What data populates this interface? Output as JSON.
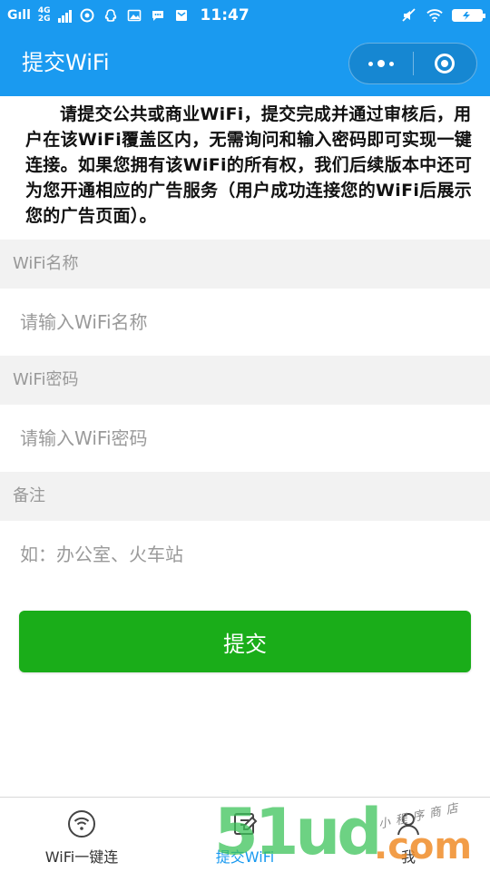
{
  "status_bar": {
    "signal1": "Gıll",
    "net_4g": "4G",
    "net_2g": "2G",
    "time": "11:47"
  },
  "header": {
    "title": "提交WiFi"
  },
  "intro": {
    "text": "请提交公共或商业WiFi，提交完成并通过审核后，用户在该WiFi覆盖区内，无需询问和输入密码即可实现一键连接。如果您拥有该WiFi的所有权，我们后续版本中还可为您开通相应的广告服务（用户成功连接您的WiFi后展示您的广告页面）。"
  },
  "form": {
    "name_label": "WiFi名称",
    "name_placeholder": "请输入WiFi名称",
    "password_label": "WiFi密码",
    "password_placeholder": "请输入WiFi密码",
    "remark_label": "备注",
    "remark_placeholder": "如：办公室、火车站",
    "submit_label": "提交"
  },
  "tabs": [
    {
      "label": "WiFi一键连",
      "icon": "wifi-icon"
    },
    {
      "label": "提交WiFi",
      "icon": "edit-icon",
      "active": true
    },
    {
      "label": "我",
      "icon": "user-icon"
    }
  ],
  "watermark": {
    "big": "51ud",
    "small": ".com",
    "note": "小程序商店"
  },
  "colors": {
    "primary": "#1a9af0",
    "submit": "#1aad19",
    "section_bg": "#f2f2f2"
  }
}
